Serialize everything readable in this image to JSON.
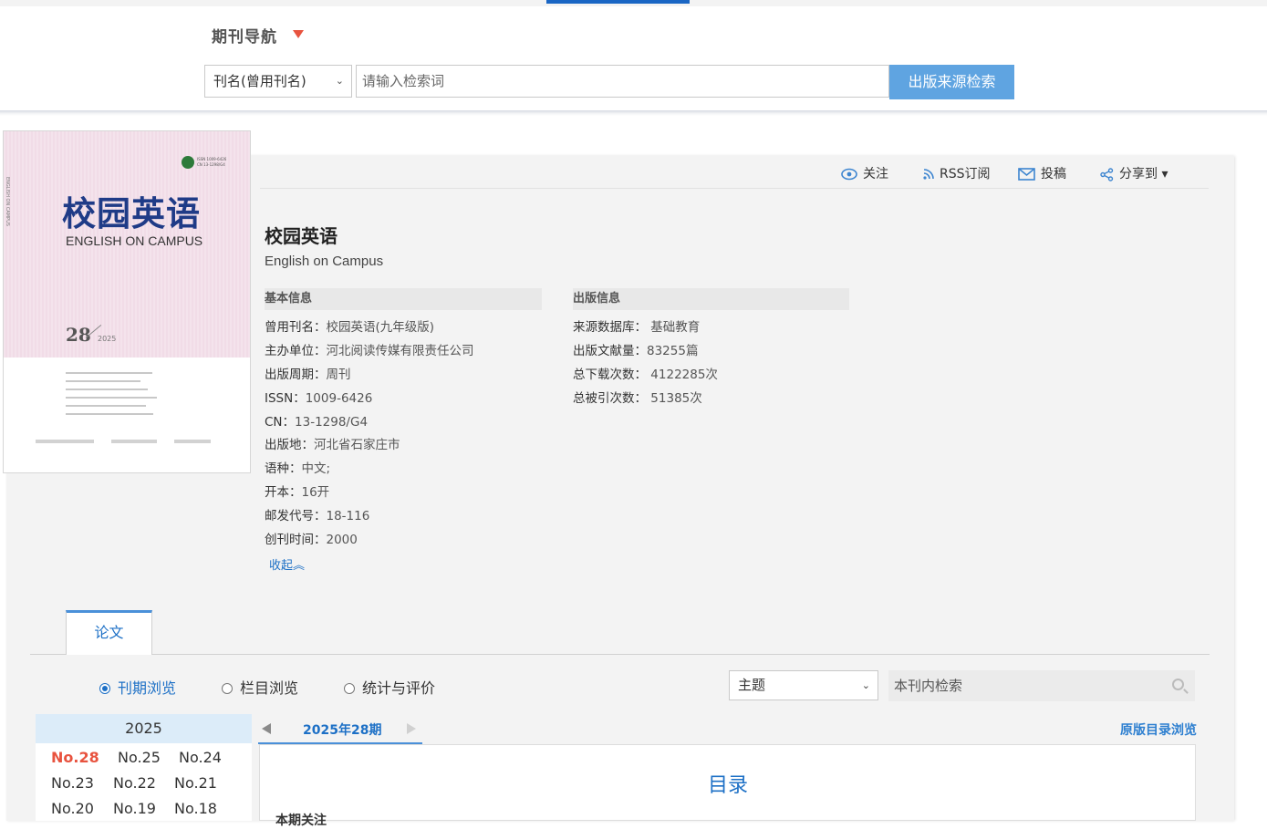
{
  "header": {
    "nav_title": "期刊导航",
    "search_field": "刊名(曾用刊名)",
    "search_placeholder": "请输入检索词",
    "search_button": "出版来源检索"
  },
  "toolbar": {
    "follow": "关注",
    "rss": "RSS订阅",
    "submit": "投稿",
    "share": "分享到 ▾"
  },
  "cover": {
    "title": "校园英语",
    "subtitle": "ENGLISH ON CAMPUS",
    "issue_number": "28",
    "issue_year": "2025",
    "issn_line1": "ISSN 1009-6426",
    "issn_line2": "CN 13-1298/G4"
  },
  "journal": {
    "title": "校园英语",
    "title_en": "English on Campus"
  },
  "basic_info": {
    "heading": "基本信息",
    "items": [
      {
        "label": "曾用刊名：",
        "value": "校园英语(九年级版)"
      },
      {
        "label": "主办单位：",
        "value": "河北阅读传媒有限责任公司"
      },
      {
        "label": "出版周期：",
        "value": "周刊"
      },
      {
        "label": "ISSN：",
        "value": "1009-6426"
      },
      {
        "label": "CN：",
        "value": "13-1298/G4"
      },
      {
        "label": "出版地：",
        "value": "河北省石家庄市"
      },
      {
        "label": "语种：",
        "value": "中文;"
      },
      {
        "label": "开本：",
        "value": "16开"
      },
      {
        "label": "邮发代号：",
        "value": "18-116"
      },
      {
        "label": "创刊时间：",
        "value": "2000"
      }
    ],
    "collapse": "收起︽"
  },
  "pub_info": {
    "heading": "出版信息",
    "items": [
      {
        "label": "来源数据库：",
        "value": "基础教育"
      },
      {
        "label": "出版文献量：",
        "value": "83255篇"
      },
      {
        "label": "总下载次数：",
        "value": "4122285次"
      },
      {
        "label": "总被引次数：",
        "value": "51385次"
      }
    ]
  },
  "tabs": {
    "papers": "论文"
  },
  "browse": {
    "options": [
      "刊期浏览",
      "栏目浏览",
      "统计与评价"
    ],
    "selected": 0,
    "topic_select": "主题",
    "inner_search_placeholder": "本刊内检索"
  },
  "issues": {
    "year": "2025",
    "list": [
      "No.28",
      "No.25",
      "No.24",
      "No.23",
      "No.22",
      "No.21",
      "No.20",
      "No.19",
      "No.18"
    ],
    "current": "No.28"
  },
  "issue_panel": {
    "tab": "2025年28期",
    "original_toc": "原版目录浏览",
    "toc_title": "目录",
    "toc_section": "本期关注"
  },
  "colors": {
    "accent": "#1d70c6",
    "button": "#5fa4e1",
    "highlight": "#e8533f"
  }
}
